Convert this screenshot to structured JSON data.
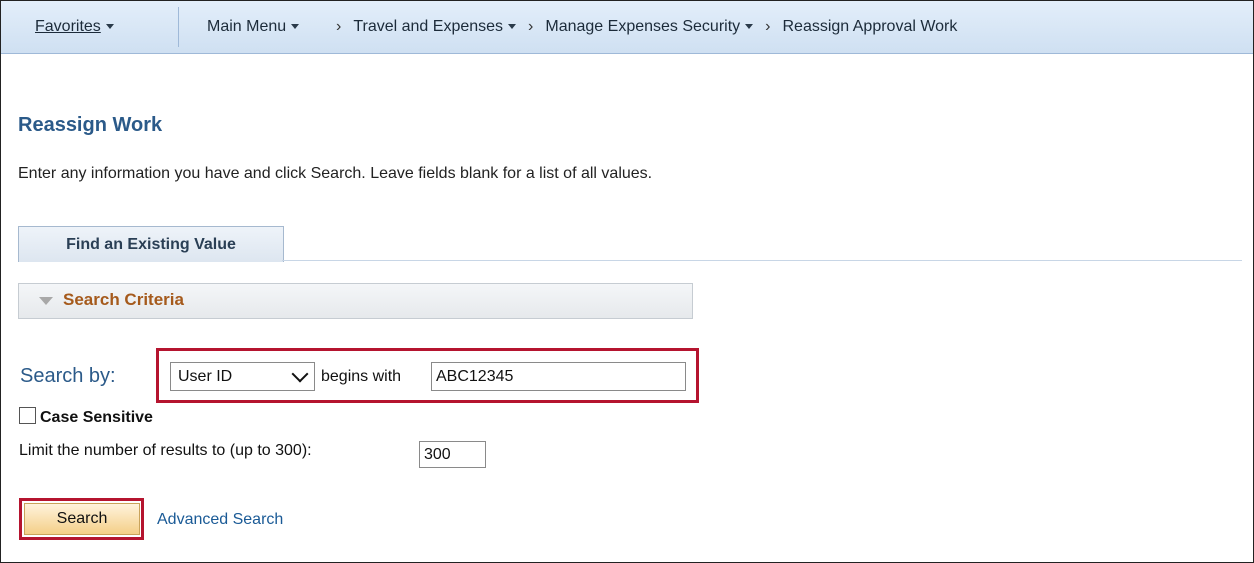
{
  "nav": {
    "favorites": "Favorites",
    "main_menu": "Main Menu",
    "crumbs": [
      "Travel and Expenses",
      "Manage Expenses Security",
      "Reassign Approval Work"
    ]
  },
  "page": {
    "title": "Reassign Work",
    "instructions": "Enter any information you have and click Search. Leave fields blank for a list of all values."
  },
  "tabs": [
    {
      "label": "Find an Existing Value"
    }
  ],
  "criteria": {
    "label": "Search Criteria"
  },
  "search_by": {
    "label": "Search by:",
    "field": "User ID",
    "operator": "begins with",
    "value": "ABC12345"
  },
  "case_sensitive": {
    "label": "Case Sensitive",
    "checked": false
  },
  "limit": {
    "label": "Limit the number of results to (up to 300):",
    "value": "300"
  },
  "buttons": {
    "search": "Search",
    "advanced": "Advanced Search"
  },
  "colors": {
    "highlight": "#b5142f",
    "title": "#2b5a89",
    "criteria": "#a55a1c",
    "link": "#1a5a96"
  }
}
